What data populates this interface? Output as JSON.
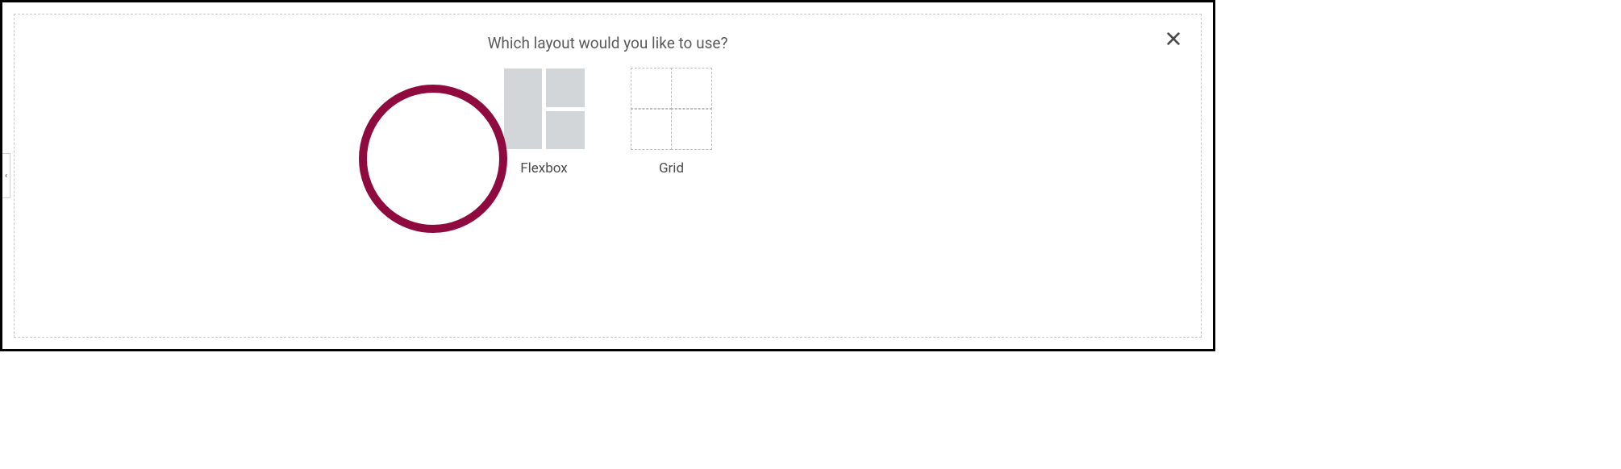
{
  "prompt": "Which layout would you like to use?",
  "options": {
    "flexbox": {
      "label": "Flexbox"
    },
    "grid": {
      "label": "Grid"
    }
  },
  "highlight": {
    "color": "#8e0a3f",
    "target": "flexbox"
  },
  "sideHandle": {
    "glyph": "‹"
  }
}
